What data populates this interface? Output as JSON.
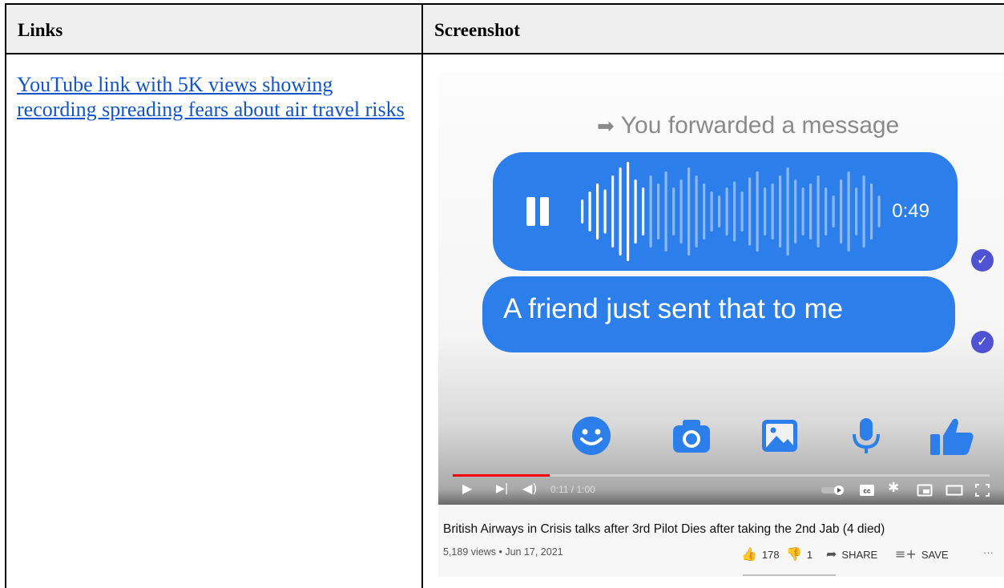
{
  "table": {
    "headers": {
      "links": "Links",
      "screenshot": "Screenshot"
    },
    "rows": [
      {
        "link_text": "YouTube link with 5K views showing recording spreading fears about air travel risks"
      }
    ]
  },
  "screenshot": {
    "forwarded_label": "You forwarded a message",
    "voice_duration": "0:49",
    "message_text": "A friend just sent that to me",
    "player": {
      "time": "0:11 / 1:00",
      "progress": 0.18
    },
    "video_title": "British Airways in Crisis talks after 3rd Pilot Dies after taking the 2nd Jab (4 died)",
    "views_date": "5,189 views • Jun 17, 2021",
    "likes": "178",
    "dislikes": "1",
    "share_label": "SHARE",
    "save_label": "SAVE",
    "more_label": "···",
    "colors": {
      "bubble": "#2c7eea",
      "link": "#1155cc",
      "header_bg": "#efefef",
      "progress": "#ff0000"
    },
    "icons": [
      "play-icon",
      "next-icon",
      "volume-icon",
      "autoplay-toggle-icon",
      "cc-icon",
      "settings-icon",
      "miniplayer-icon",
      "theater-icon",
      "fullscreen-icon",
      "emoji-icon",
      "camera-icon",
      "image-icon",
      "microphone-icon",
      "thumbs-up-icon"
    ]
  }
}
